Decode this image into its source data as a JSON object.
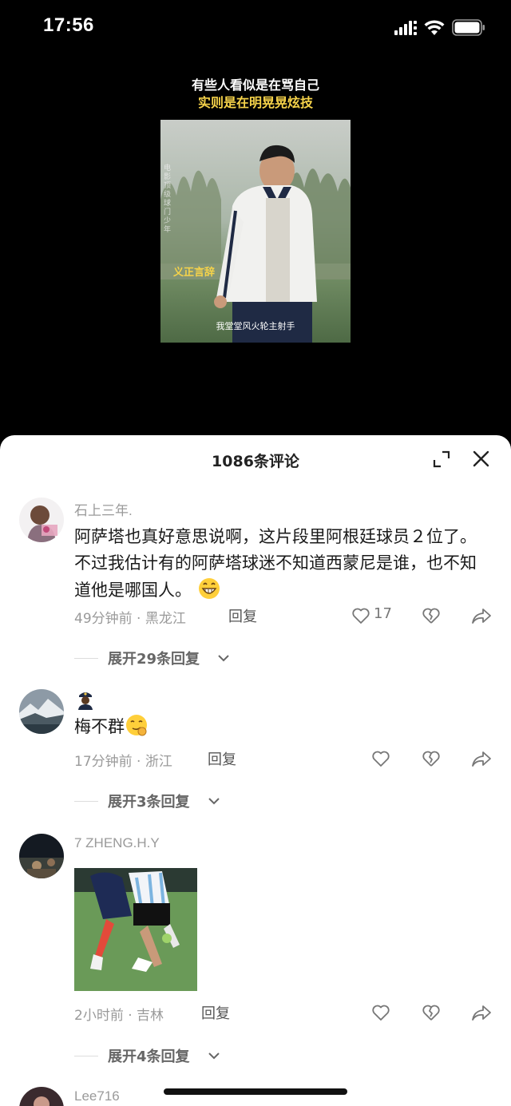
{
  "status_bar": {
    "time": "17:56"
  },
  "video": {
    "caption_line1": "有些人看似是在骂自己",
    "caption_line2": "实则是在明晃晃炫技",
    "overlay_yellow": "义正言辞",
    "overlay_white": "我堂堂风火轮主射手",
    "overlay_vertical": "电影 顶级球门少年"
  },
  "sheet": {
    "title": "1086条评论"
  },
  "comments": [
    {
      "username": "石上三年.",
      "text": "阿萨塔也真好意思说啊，这片段里阿根廷球员２位了。不过我估计有的阿萨塔球迷不知道西蒙尼是谁，也不知道他是哪国人。",
      "emoji": "grinning-emoji",
      "meta": "49分钟前 · 黑龙江",
      "reply_label": "回复",
      "likes": "17",
      "expand_label": "展开29条回复"
    },
    {
      "username": "",
      "badge": "police-officer-emoji",
      "text": "梅不群",
      "emoji": "smirk-emoji",
      "meta": "17分钟前 · 浙江",
      "reply_label": "回复",
      "likes": "",
      "expand_label": "展开3条回复"
    },
    {
      "username": "7 ZHENG.H.Y",
      "image": "football-players-image",
      "meta": "2小时前 · 吉林",
      "reply_label": "回复",
      "likes": "",
      "expand_label": "展开4条回复"
    },
    {
      "username": "Lee716"
    }
  ]
}
